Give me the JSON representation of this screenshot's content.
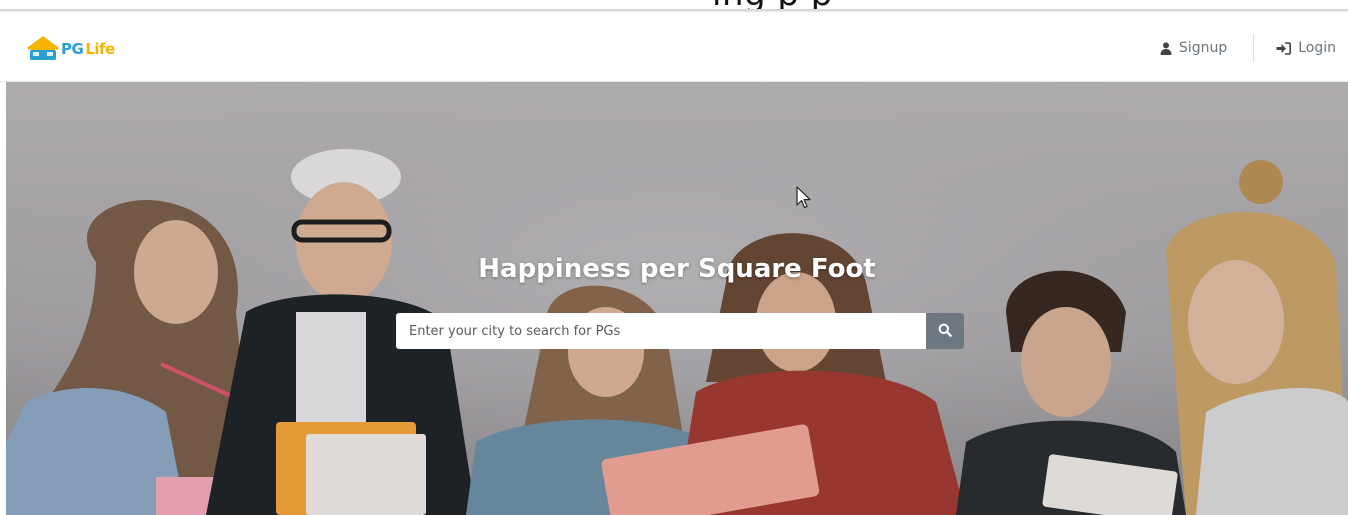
{
  "caption": {
    "text": "ing p           p"
  },
  "navbar": {
    "brand": {
      "pg": "PG",
      "life": "Life",
      "logo_icon": "house-icon"
    },
    "signup": {
      "label": "Signup",
      "icon": "user-icon"
    },
    "login": {
      "label": "Login",
      "icon": "sign-in-icon"
    }
  },
  "hero": {
    "title": "Happiness per Square Foot",
    "search": {
      "placeholder": "Enter your city to search for PGs",
      "value": "",
      "button_icon": "search-icon"
    }
  },
  "colors": {
    "brand_blue": "#2a9fd6",
    "brand_yellow": "#f4b400",
    "search_button": "#6c7780"
  }
}
